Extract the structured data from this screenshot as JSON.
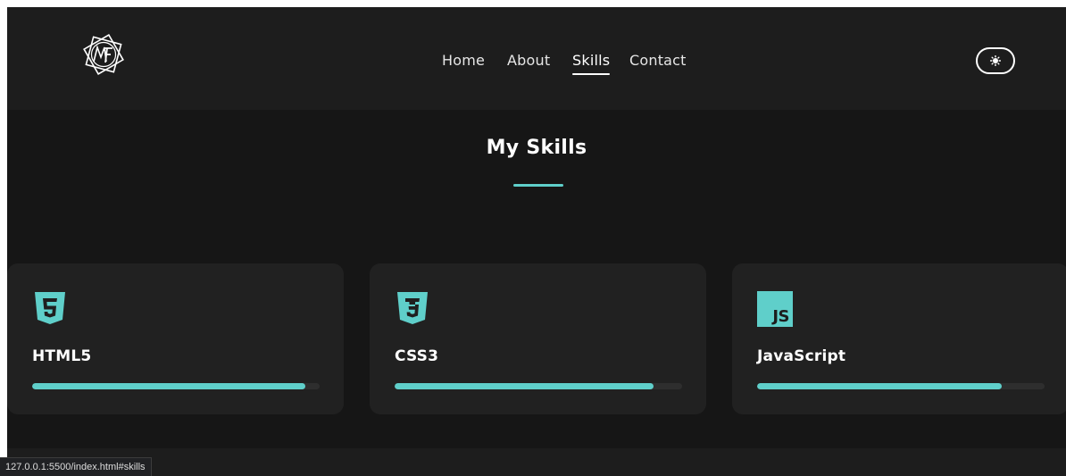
{
  "nav": {
    "links": [
      {
        "label": "Home"
      },
      {
        "label": "About"
      },
      {
        "label": "Skills",
        "active": true
      },
      {
        "label": "Contact"
      }
    ],
    "logo_icon": "mf-star-logo-icon",
    "theme_icon": "sun-icon"
  },
  "section": {
    "title": "My Skills"
  },
  "skills": [
    {
      "name": "HTML5",
      "icon": "html5-icon",
      "level": 0.95
    },
    {
      "name": "CSS3",
      "icon": "css3-icon",
      "level": 0.9
    },
    {
      "name": "JavaScript",
      "icon": "javascript-icon",
      "icon_text": "JS",
      "level": 0.85
    }
  ],
  "status_bar": {
    "url": "127.0.0.1:5500/index.html#skills"
  },
  "colors": {
    "accent": "#5fcfca",
    "background": "#161616",
    "header": "#1d1d1d",
    "card": "#212121"
  }
}
